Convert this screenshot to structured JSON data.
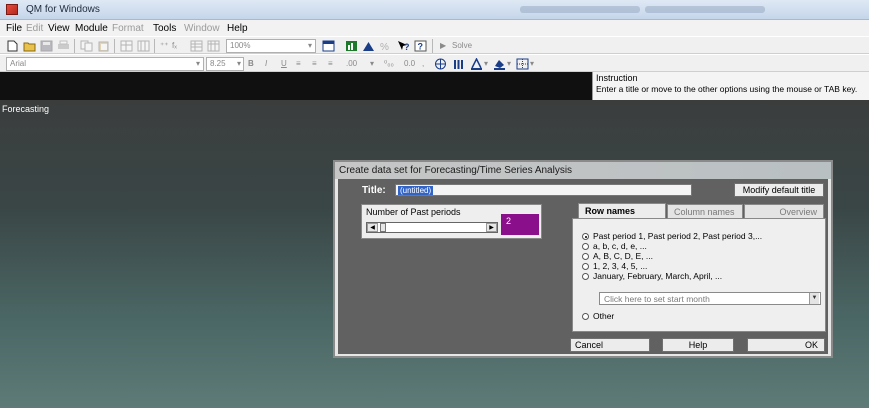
{
  "window": {
    "title": "QM for Windows"
  },
  "menubar": {
    "file": "File",
    "edit": "Edit",
    "view": "View",
    "module": "Module",
    "format": "Format",
    "tools": "Tools",
    "window": "Window",
    "help": "Help"
  },
  "toolbar": {
    "zoom": "100%",
    "solve": "Solve",
    "font_name": "Arial",
    "font_size": "8.25",
    "decimals": ".00",
    "decimal_fmt": "0.0"
  },
  "instruction": {
    "heading": "Instruction",
    "text": "Enter a title or move to the other options using the mouse or TAB key."
  },
  "workspace": {
    "module_label": "Forecasting"
  },
  "dialog": {
    "title": "Create data set for Forecasting/Time Series Analysis",
    "title_label": "Title:",
    "title_value": "(untitled)",
    "modify_button": "Modify default title",
    "periods_label": "Number of Past periods",
    "periods_value": "2",
    "tabs": [
      {
        "label": "Row names",
        "active": true
      },
      {
        "label": "Column names",
        "active": false
      },
      {
        "label": "Overview",
        "active": false
      }
    ],
    "row_name_options": [
      {
        "label": "Past period 1, Past period 2, Past period 3,...",
        "checked": true
      },
      {
        "label": "a, b, c, d, e, ...",
        "checked": false
      },
      {
        "label": "A, B, C, D, E, ...",
        "checked": false
      },
      {
        "label": "1, 2, 3, 4, 5, ...",
        "checked": false
      },
      {
        "label": "January, February, March, April, ...",
        "checked": false
      },
      {
        "label": "Other",
        "checked": false
      }
    ],
    "start_month_placeholder": "Click here to set start month",
    "cancel_button": "Cancel",
    "help_button": "Help",
    "ok_button": "OK"
  }
}
